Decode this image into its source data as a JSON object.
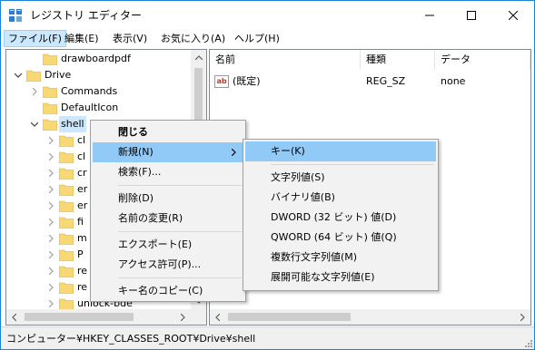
{
  "window": {
    "title": "レジストリ エディター"
  },
  "menubar": [
    "ファイル(F)",
    "編集(E)",
    "表示(V)",
    "お気に入り(A)",
    "ヘルプ(H)"
  ],
  "tree": {
    "items": [
      {
        "label": "drawboardpdf",
        "expander": "none"
      },
      {
        "label": "Drive",
        "expander": "expanded"
      },
      {
        "label": "Commands",
        "expander": "collapsed"
      },
      {
        "label": "DefaultIcon",
        "expander": "none"
      },
      {
        "label": "shell",
        "expander": "expanded",
        "selected": true
      },
      {
        "label": "cl",
        "expander": "collapsed"
      },
      {
        "label": "cl",
        "expander": "collapsed"
      },
      {
        "label": "cr",
        "expander": "collapsed"
      },
      {
        "label": "er",
        "expander": "collapsed"
      },
      {
        "label": "er",
        "expander": "collapsed"
      },
      {
        "label": "fi",
        "expander": "collapsed"
      },
      {
        "label": "m",
        "expander": "collapsed"
      },
      {
        "label": "P",
        "expander": "collapsed"
      },
      {
        "label": "re",
        "expander": "collapsed"
      },
      {
        "label": "re",
        "expander": "collapsed"
      },
      {
        "label": "unlock-bde",
        "expander": "collapsed"
      }
    ]
  },
  "list": {
    "columns": [
      "名前",
      "種類",
      "データ"
    ],
    "rows": [
      {
        "name": "(既定)",
        "type": "REG_SZ",
        "data": "none",
        "icon": "string-value-icon",
        "icon_text": "ab"
      }
    ]
  },
  "status": "コンピューター¥HKEY_CLASSES_ROOT¥Drive¥shell",
  "context_menu": {
    "items": [
      {
        "label": "閉じる",
        "bold": true
      },
      {
        "label": "新規(N)",
        "submenu": true,
        "highlighted": true
      },
      {
        "label": "検索(F)..."
      },
      {
        "separator": true
      },
      {
        "label": "削除(D)"
      },
      {
        "label": "名前の変更(R)"
      },
      {
        "separator": true
      },
      {
        "label": "エクスポート(E)"
      },
      {
        "label": "アクセス許可(P)..."
      },
      {
        "separator": true
      },
      {
        "label": "キー名のコピー(C)"
      }
    ]
  },
  "submenu": {
    "items": [
      {
        "label": "キー(K)",
        "highlighted": true
      },
      {
        "separator": true
      },
      {
        "label": "文字列値(S)"
      },
      {
        "label": "バイナリ値(B)"
      },
      {
        "label": "DWORD (32 ビット) 値(D)"
      },
      {
        "label": "QWORD (64 ビット) 値(Q)"
      },
      {
        "label": "複数行文字列値(M)"
      },
      {
        "label": "展開可能な文字列値(E)"
      }
    ]
  },
  "colors": {
    "accent_border": "#1883d7",
    "selection": "#cce8ff",
    "menu_highlight": "#91c9f7",
    "folder": "#f8d775",
    "value_icon_red": "#c0392b"
  }
}
